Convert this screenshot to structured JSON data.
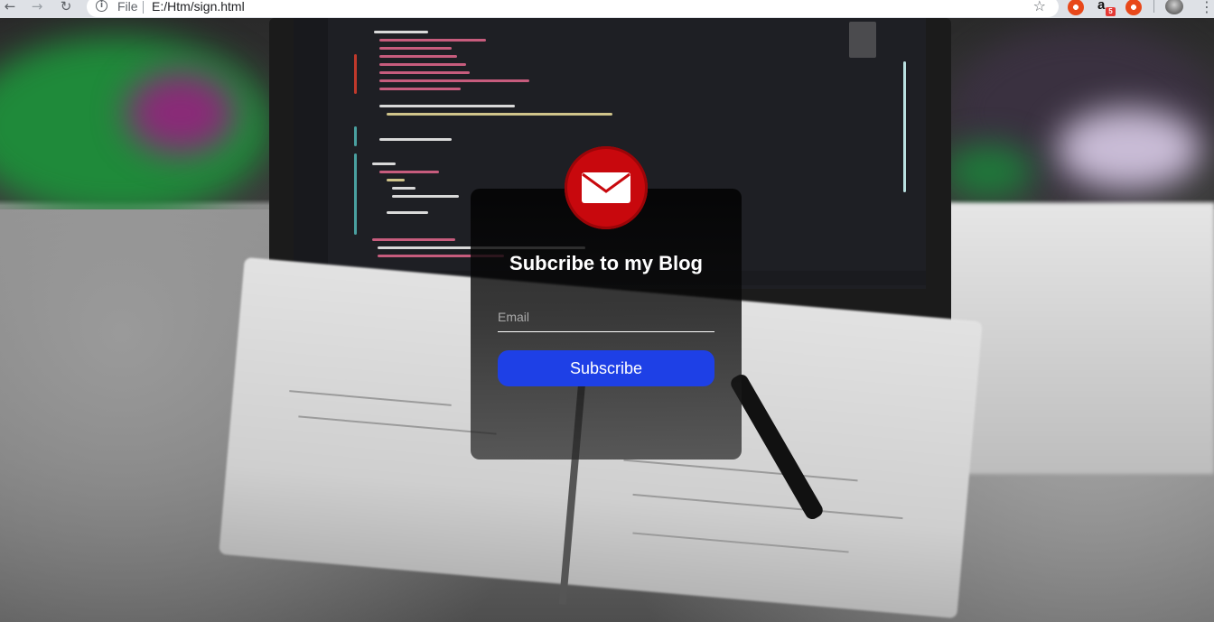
{
  "browser": {
    "url_scheme": "File",
    "url": "E:/Htm/sign.html",
    "icons": {
      "back": "back-arrow-icon",
      "forward": "forward-arrow-icon",
      "reload": "reload-icon",
      "info": "info-icon",
      "bookmark": "star-icon",
      "menu": "kebab-menu-icon"
    },
    "extensions": [
      {
        "name": "infinity-extension-icon",
        "color": "#e8481a"
      },
      {
        "name": "amazon-assistant-icon",
        "label": "a",
        "badge": "5"
      },
      {
        "name": "infinity-extension-icon",
        "color": "#e8481a"
      }
    ]
  },
  "form": {
    "icon": "envelope-icon",
    "title": "Subcribe to my Blog",
    "email_placeholder": "Email",
    "email_value": "",
    "button_label": "Subscribe"
  },
  "colors": {
    "accent_button": "#1e40e6",
    "mail_badge": "#c8080d",
    "card_text": "#ffffff"
  }
}
